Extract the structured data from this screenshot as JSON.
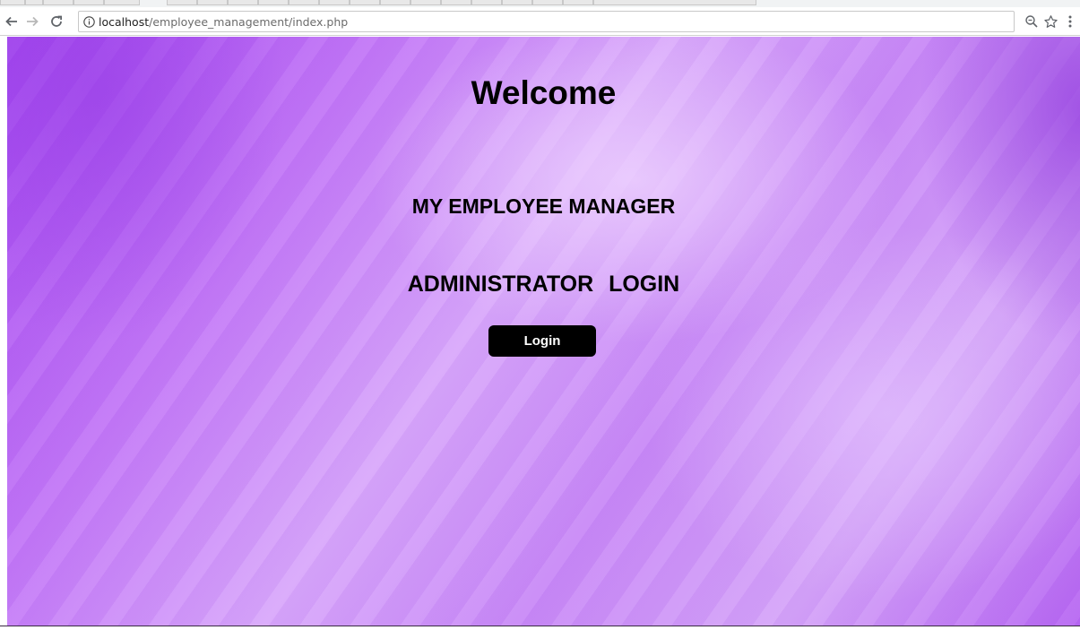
{
  "browser": {
    "url_host": "localhost",
    "url_path": "/employee_management/index.php"
  },
  "page": {
    "welcome": "Welcome",
    "app_title": "MY EMPLOYEE MANAGER",
    "admin_heading": "ADMINISTRATOR LOGIN",
    "login_button": "Login"
  },
  "colors": {
    "background_accent": "#c378f7",
    "button_bg": "#000000",
    "button_text": "#ffffff"
  },
  "icons": {
    "back": "back-arrow-icon",
    "forward": "forward-arrow-icon",
    "reload": "reload-icon",
    "info": "info-icon",
    "zoom": "zoom-icon",
    "bookmark": "star-icon",
    "menu": "kebab-menu-icon"
  }
}
